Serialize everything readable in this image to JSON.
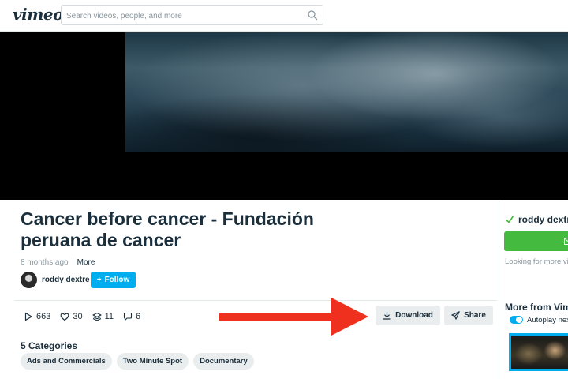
{
  "header": {
    "logo": "vimeo",
    "search_placeholder": "Search videos, people, and more",
    "search_icon": "search-icon"
  },
  "video": {
    "title": "Cancer before cancer - Fundación peruana de cancer",
    "posted": "8 months ago",
    "more_label": "More",
    "author": "roddy dextre",
    "follow_label": "Follow",
    "stats": {
      "plays": "663",
      "likes": "30",
      "collections": "11",
      "comments": "6"
    },
    "download_label": "Download",
    "share_label": "Share",
    "categories_title": "5 Categories",
    "categories": [
      "Ads and Commercials",
      "Two Minute Spot",
      "Documentary"
    ]
  },
  "annotation": {
    "arrow_color": "#f0301e"
  },
  "sidebar": {
    "author_name": "roddy dextre",
    "looking_text": "Looking for more vi",
    "more_from": "More from Vim",
    "autoplay_label": "Autoplay nex"
  },
  "colors": {
    "accent": "#00adef",
    "green": "#44bb3f",
    "text": "#1a2e3b"
  }
}
